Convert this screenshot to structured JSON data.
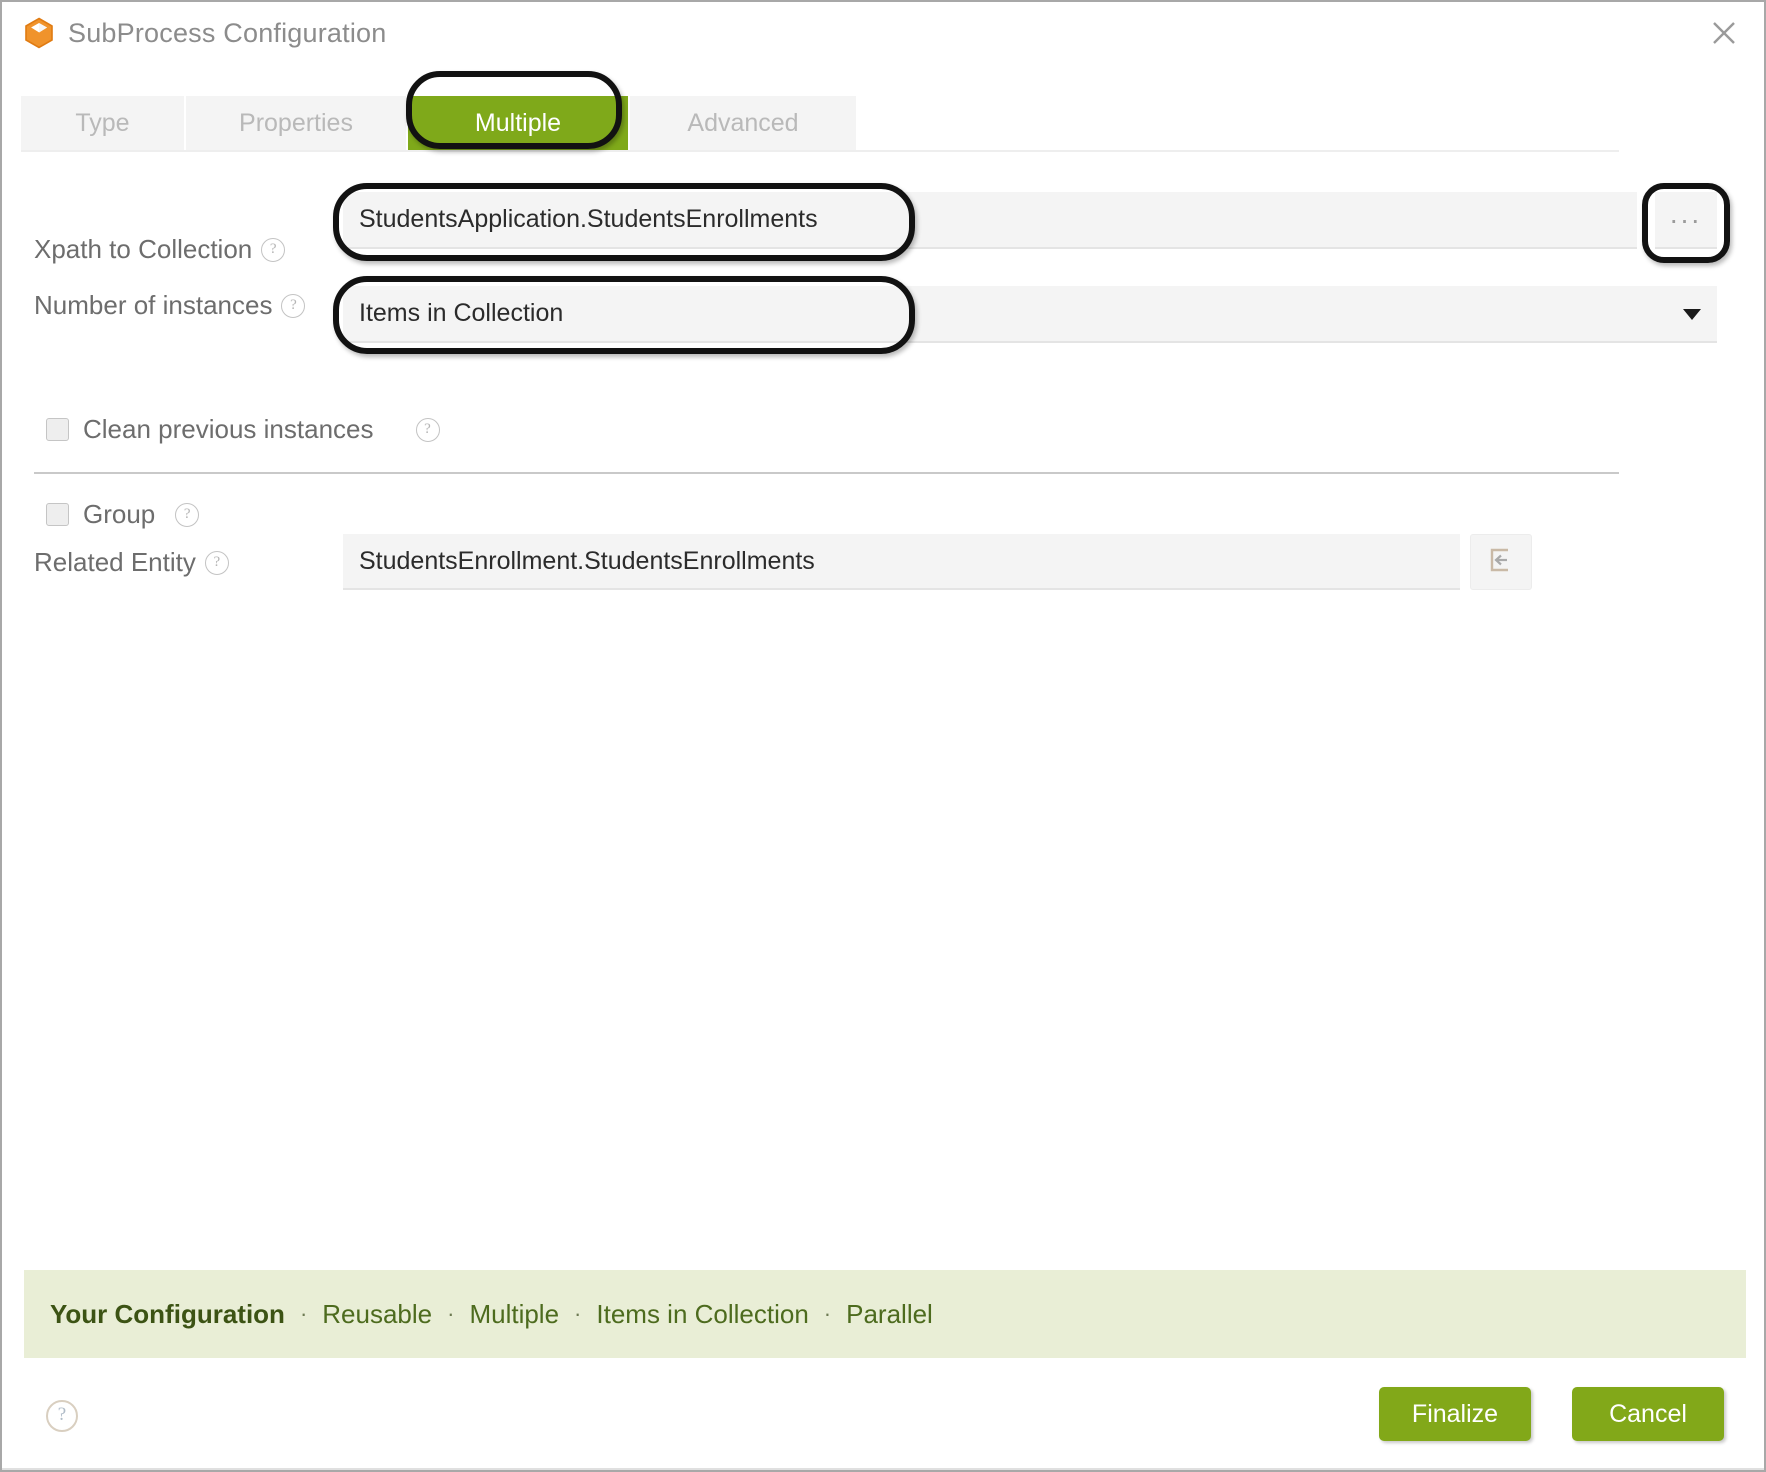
{
  "window": {
    "title": "SubProcess Configuration",
    "app_icon": "hexagon-cube-icon",
    "close_icon": "close-icon",
    "accent_green": "#7fa91a",
    "banner_green": "#e9eed6",
    "annotation_color": "#121212"
  },
  "tabs": [
    {
      "label": "Type",
      "active": false
    },
    {
      "label": "Properties",
      "active": false
    },
    {
      "label": "Multiple",
      "active": true
    },
    {
      "label": "Advanced",
      "active": false
    }
  ],
  "form": {
    "xpath": {
      "label": "Xpath to Collection",
      "help": "?",
      "value": "StudentsApplication.StudentsEnrollments",
      "placeholder": "",
      "browse_button": "..."
    },
    "instances": {
      "label": "Number of instances",
      "help": "?",
      "value": "Items in Collection",
      "options": [
        "Items in Collection"
      ],
      "caret_icon": "chevron-down-icon"
    },
    "clean_previous": {
      "label": "Clean previous instances",
      "help": "?",
      "checked": false
    },
    "group": {
      "label": "Group",
      "help": "?",
      "checked": false
    },
    "related_entity": {
      "label": "Related Entity",
      "help": "?",
      "value": "StudentsEnrollment.StudentsEnrollments",
      "placeholder": "",
      "goto_icon": "go-to-entity-icon"
    }
  },
  "summary": {
    "title": "Your Configuration",
    "separator": "·",
    "items": [
      "Reusable",
      "Multiple",
      "Items in Collection",
      "Parallel"
    ]
  },
  "footer": {
    "help": "?",
    "finalize_label": "Finalize",
    "cancel_label": "Cancel"
  }
}
